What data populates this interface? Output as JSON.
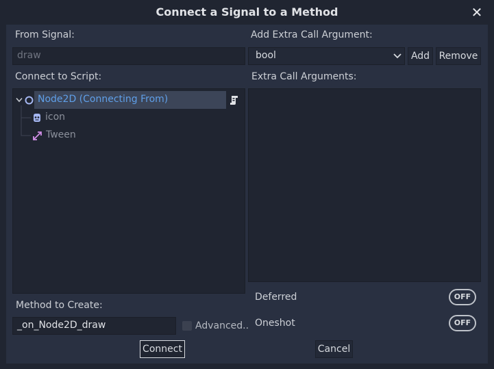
{
  "dialog": {
    "title": "Connect a Signal to a Method",
    "close_icon": "close-icon"
  },
  "from_signal": {
    "label": "From Signal:",
    "value": "draw"
  },
  "extra_arg": {
    "label": "Add Extra Call Argument:",
    "type_selected": "bool",
    "add_label": "Add",
    "remove_label": "Remove"
  },
  "connect_to_script": {
    "label": "Connect to Script:",
    "tree": [
      {
        "label": "Node2D (Connecting From)",
        "icon": "node2d-icon",
        "selected": true
      },
      {
        "label": "icon",
        "icon": "sprite-icon",
        "selected": false
      },
      {
        "label": "Tween",
        "icon": "tween-icon",
        "selected": false
      }
    ]
  },
  "extra_call_args": {
    "label": "Extra Call Arguments:"
  },
  "method": {
    "label": "Method to Create:",
    "value": "_on_Node2D_draw",
    "advanced_label": "Advanced.."
  },
  "options": {
    "deferred_label": "Deferred",
    "deferred_state": "OFF",
    "oneshot_label": "Oneshot",
    "oneshot_state": "OFF"
  },
  "actions": {
    "connect_label": "Connect",
    "cancel_label": "Cancel"
  },
  "colors": {
    "background": "#202531",
    "panel": "#293041",
    "selected_text": "#5f9fe8",
    "dim_text": "#8b909b",
    "selection": "#3c4558"
  }
}
